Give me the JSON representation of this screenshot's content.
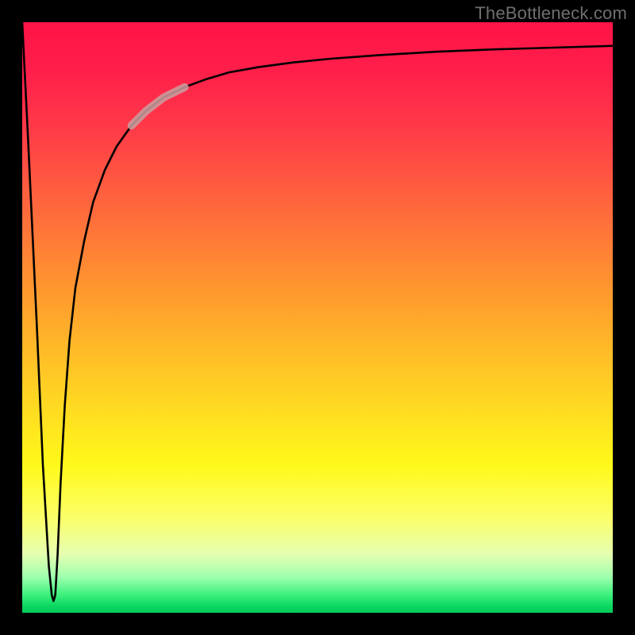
{
  "watermark": "TheBottleneck.com",
  "colors": {
    "frame": "#000000",
    "curve": "#000000",
    "highlightStroke": "#caa0a0",
    "highlightOpacity": 0.85
  },
  "chart_data": {
    "type": "line",
    "title": "",
    "xlabel": "",
    "ylabel": "",
    "xlim": [
      0,
      100
    ],
    "ylim": [
      0,
      100
    ],
    "grid": false,
    "legend": false,
    "note": "No tick labels are rendered; y-range is normalized 0–100 where 0 is bottom (green) and 100 is top (red). x is normalized 0–100 left→right.",
    "series": [
      {
        "name": "bottleneck-curve",
        "x": [
          0.0,
          1.0,
          2.5,
          3.5,
          4.5,
          5.0,
          5.3,
          5.6,
          6.0,
          6.5,
          7.2,
          8.0,
          9.0,
          10.5,
          12.0,
          14.0,
          16.0,
          18.5,
          21.0,
          24.0,
          27.5,
          31.0,
          35.0,
          40.0,
          46.0,
          52.0,
          60.0,
          70.0,
          80.0,
          90.0,
          100.0
        ],
        "y": [
          100.0,
          80.0,
          48.0,
          25.0,
          8.0,
          3.0,
          2.0,
          3.0,
          10.0,
          22.0,
          35.0,
          46.0,
          55.0,
          63.0,
          69.5,
          75.0,
          79.0,
          82.5,
          85.0,
          87.3,
          89.0,
          90.3,
          91.5,
          92.4,
          93.2,
          93.8,
          94.4,
          95.0,
          95.4,
          95.7,
          96.0
        ]
      }
    ],
    "highlight_segment": {
      "series": "bottleneck-curve",
      "x_range": [
        18.5,
        27.5
      ],
      "description": "lighter thick stroke segment on the rising curve"
    },
    "background_gradient_stops": [
      {
        "pos": 0.0,
        "color": "#ff1447"
      },
      {
        "pos": 0.18,
        "color": "#ff3a48"
      },
      {
        "pos": 0.46,
        "color": "#ff9a2e"
      },
      {
        "pos": 0.75,
        "color": "#fff91a"
      },
      {
        "pos": 0.94,
        "color": "#9dffae"
      },
      {
        "pos": 1.0,
        "color": "#06c95a"
      }
    ]
  }
}
